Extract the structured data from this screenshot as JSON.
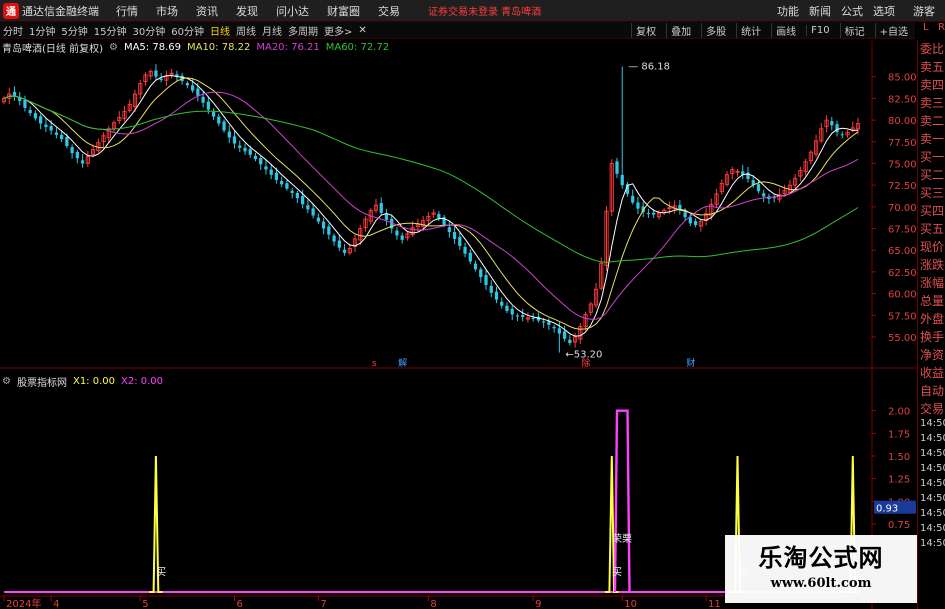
{
  "app": {
    "title": "通达信金融终端",
    "logo_glyph": "通",
    "menu": [
      "行情",
      "市场",
      "资讯",
      "发现",
      "问小达",
      "财富圈",
      "交易"
    ],
    "notice": "证券交易未登录  青岛啤酒",
    "right_menu": [
      "功能",
      "新闻",
      "公式",
      "选项",
      "游客"
    ]
  },
  "toolbar": {
    "periods": [
      "分时",
      "1分钟",
      "5分钟",
      "15分钟",
      "30分钟",
      "60分钟",
      "日线",
      "周线",
      "月线",
      "多周期",
      "更多>"
    ],
    "active_period": "日线",
    "right": [
      "复权",
      "叠加",
      "多股",
      "统计",
      "画线",
      "F10",
      "标记",
      "+自选"
    ]
  },
  "main_info": {
    "stock": "青岛啤酒(日线 前复权)",
    "ma5": "MA5: 78.69",
    "ma10": "MA10: 78.22",
    "ma20": "MA20: 76.21",
    "ma60": "MA60: 72.72"
  },
  "indicator_info": {
    "name": "股票指标网",
    "x1": "X1: 0.00",
    "x2": "X2: 0.00"
  },
  "colors": {
    "up": "#ff3b3b",
    "down": "#2ec8e6",
    "ma5": "#ffffff",
    "ma10": "#e8e060",
    "ma20": "#d040d0",
    "ma60": "#30c030",
    "x1": "#ffff40",
    "x2": "#ff40ff"
  },
  "chart_data": [
    {
      "type": "candlestick",
      "y_ticks": [
        "85.00",
        "82.50",
        "80.00",
        "77.50",
        "75.00",
        "72.50",
        "70.00",
        "67.50",
        "65.00",
        "62.50",
        "60.00",
        "57.50",
        "55.00"
      ],
      "ylim": [
        53.5,
        87.5
      ],
      "close": [
        82.5,
        83.0,
        82.8,
        82.2,
        81.4,
        80.8,
        80.2,
        79.6,
        79.2,
        78.8,
        78.3,
        77.8,
        77.0,
        76.2,
        75.6,
        75.0,
        75.8,
        76.6,
        77.4,
        78.2,
        79.0,
        79.7,
        80.3,
        81.0,
        81.8,
        83.0,
        84.2,
        85.2,
        85.6,
        85.0,
        84.6,
        85.1,
        85.4,
        85.0,
        84.5,
        84.0,
        83.4,
        82.8,
        82.0,
        81.2,
        80.4,
        79.6,
        78.8,
        78.0,
        77.3,
        76.8,
        76.4,
        76.0,
        75.5,
        74.9,
        74.3,
        73.7,
        73.1,
        72.6,
        72.1,
        71.6,
        71.0,
        70.3,
        69.7,
        69.0,
        68.3,
        67.5,
        66.8,
        66.0,
        65.3,
        64.7,
        65.2,
        66.3,
        67.5,
        68.6,
        69.6,
        70.2,
        69.3,
        68.5,
        67.5,
        66.7,
        66.2,
        66.9,
        67.6,
        68.0,
        68.4,
        68.9,
        69.3,
        68.7,
        67.9,
        67.1,
        66.3,
        65.5,
        64.6,
        63.7,
        62.8,
        61.9,
        61.0,
        60.1,
        59.3,
        58.6,
        58.0,
        57.6,
        57.4,
        57.3,
        57.2,
        57.1,
        56.9,
        56.7,
        56.4,
        56.0,
        55.4,
        54.8,
        54.3,
        55.0,
        56.2,
        57.6,
        58.8,
        60.5,
        63.5,
        69.5,
        75.0,
        73.8,
        72.5,
        71.5,
        70.5,
        69.8,
        69.4,
        69.2,
        69.1,
        69.3,
        69.6,
        69.9,
        70.1,
        69.6,
        68.8,
        68.1,
        67.9,
        68.3,
        69.2,
        70.3,
        71.5,
        72.7,
        73.7,
        74.3,
        74.1,
        73.7,
        73.2,
        72.5,
        71.8,
        71.2,
        70.9,
        71.0,
        71.4,
        71.9,
        72.5,
        73.3,
        74.2,
        75.2,
        76.3,
        77.6,
        79.0,
        80.0,
        79.4,
        78.6,
        78.3,
        78.6,
        79.1,
        79.6
      ],
      "annotations": [
        {
          "label": "86.18",
          "index": 118,
          "value": 86.18
        },
        {
          "label": "53.20",
          "index": 106,
          "value": 53.2
        }
      ],
      "event_markers": [
        {
          "label": "s",
          "index": 71
        },
        {
          "label": "解",
          "index": 76
        },
        {
          "label": "除",
          "index": 111
        },
        {
          "label": "财",
          "index": 131
        }
      ]
    },
    {
      "type": "line",
      "y_ticks": [
        "2.00",
        "1.75",
        "1.50",
        "1.25",
        "1.00",
        "0.75"
      ],
      "ylim": [
        0,
        2.25
      ],
      "current_value": "0.93",
      "series": [
        {
          "name": "X1",
          "spikes": [
            {
              "index": 29,
              "value": 1.5
            },
            {
              "index": 116,
              "value": 1.5
            },
            {
              "index": 140,
              "value": 1.5
            },
            {
              "index": 162,
              "value": 1.5
            }
          ]
        },
        {
          "name": "X2",
          "blocks": [
            {
              "start": 117,
              "end": 119,
              "value": 2.0
            }
          ]
        }
      ],
      "spike_labels": [
        {
          "label": "买",
          "index": 30
        },
        {
          "label": "荣栗",
          "index": 117
        },
        {
          "label": "买",
          "index": 117
        },
        {
          "label": "买",
          "index": 141
        }
      ],
      "x_labels": [
        {
          "label": "2024年",
          "index": 0
        },
        {
          "label": "4",
          "index": 9
        },
        {
          "label": "5",
          "index": 26
        },
        {
          "label": "6",
          "index": 44
        },
        {
          "label": "7",
          "index": 60
        },
        {
          "label": "8",
          "index": 81
        },
        {
          "label": "9",
          "index": 101
        },
        {
          "label": "10",
          "index": 118
        },
        {
          "label": "11",
          "index": 134
        }
      ]
    }
  ],
  "side_panel": {
    "items": [
      "委比",
      "卖五",
      "卖四",
      "卖三",
      "卖二",
      "卖一",
      "买一",
      "买二",
      "买三",
      "买四",
      "买五",
      "现价",
      "涨跌",
      "涨幅",
      "总量",
      "外盘",
      "换手",
      "净资",
      "收益",
      "自动",
      "交易"
    ],
    "side_letters": [
      "L",
      "R"
    ],
    "times": [
      "14:50",
      "14:50",
      "14:50",
      "14:50",
      "14:50",
      "14:50",
      "14:50",
      "14:50",
      "14:50"
    ]
  },
  "watermark": {
    "title": "乐淘公式网",
    "url": "www.60lt.com"
  }
}
